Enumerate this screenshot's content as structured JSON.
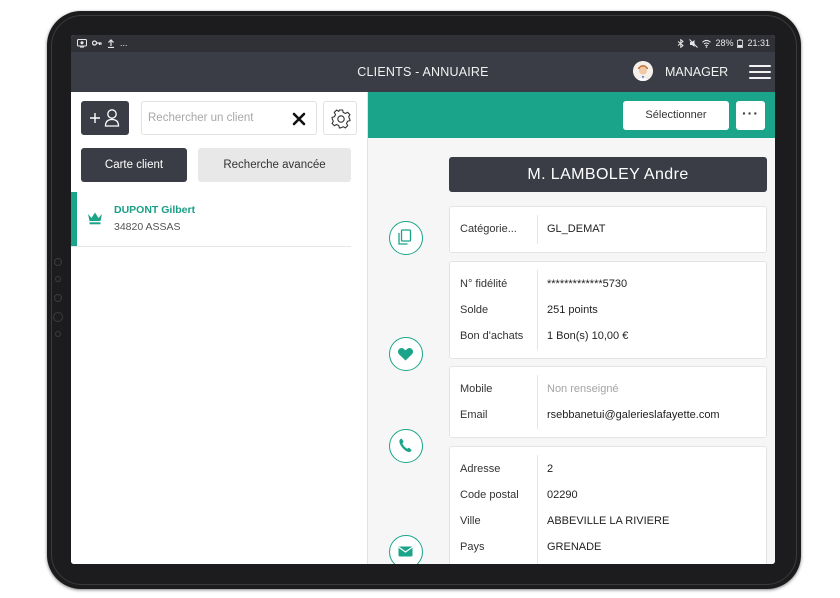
{
  "statusbar": {
    "left_icons": [
      "screen-icon",
      "key-icon",
      "upload-icon"
    ],
    "left_more": "...",
    "battery": "28%",
    "time": "21:31"
  },
  "appbar": {
    "title": "CLIENTS - ANNUAIRE",
    "user_label": "MANAGER"
  },
  "left": {
    "search_placeholder": "Rechercher un client",
    "tab_card_label": "Carte client",
    "tab_advanced_label": "Recherche avancée",
    "clients": [
      {
        "name": "DUPONT Gilbert",
        "city": "34820 ASSAS"
      }
    ]
  },
  "right": {
    "select_label": "Sélectionner",
    "more_label": "···",
    "client_name": "M.  LAMBOLEY  Andre",
    "category": {
      "label": "Catégorie...",
      "value": "GL_DEMAT"
    },
    "loyalty": [
      {
        "label": "N° fidélité",
        "value": "*************5730"
      },
      {
        "label": "Solde",
        "value": "251 points"
      },
      {
        "label": "Bon d'achats",
        "value": "1 Bon(s) 10,00 €"
      }
    ],
    "contact": [
      {
        "label": "Mobile",
        "value": "Non renseigné"
      },
      {
        "label": "Email",
        "value": "rsebbanetui@galerieslafayette.com"
      }
    ],
    "address": [
      {
        "label": "Adresse",
        "value": "2"
      },
      {
        "label": "Code postal",
        "value": "02290"
      },
      {
        "label": "Ville",
        "value": "ABBEVILLE LA RIVIERE"
      },
      {
        "label": "Pays",
        "value": "GRENADE"
      }
    ]
  },
  "colors": {
    "accent": "#1aa58a",
    "dark": "#3a3d45"
  }
}
